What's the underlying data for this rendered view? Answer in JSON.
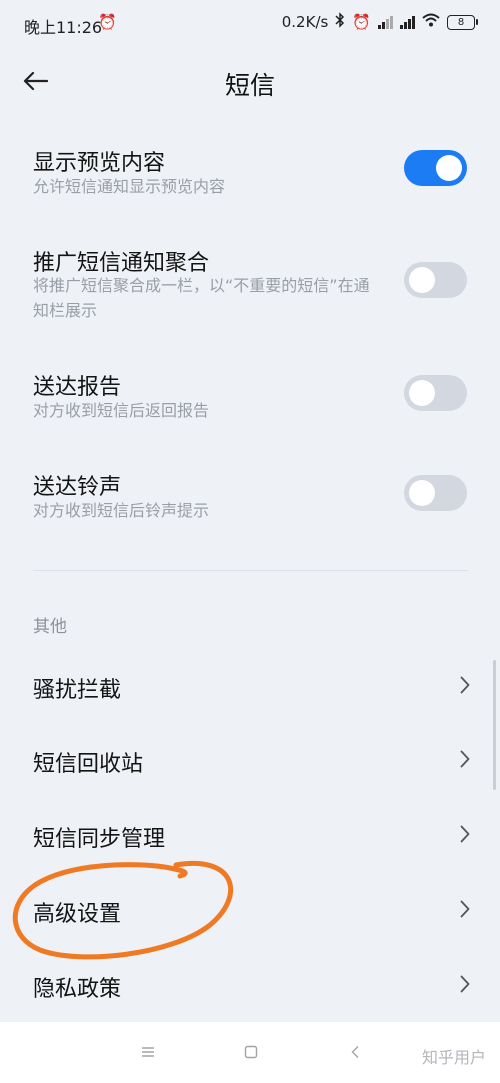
{
  "status_bar": {
    "time": "晚上11:26",
    "network_speed": "0.2K/s",
    "battery": "8",
    "icons": [
      "alarm-icon",
      "bluetooth-icon",
      "signal-icon",
      "hd-signal-icon",
      "wifi-icon",
      "battery-icon"
    ]
  },
  "header": {
    "title": "短信",
    "back_icon": "arrow-left-icon"
  },
  "settings": [
    {
      "label": "显示预览内容",
      "desc": "允许短信通知显示预览内容",
      "enabled": true
    },
    {
      "label": "推广短信通知聚合",
      "desc": "将推广短信聚合成一栏，以“不重要的短信”在通知栏展示",
      "enabled": false
    },
    {
      "label": "送达报告",
      "desc": "对方收到短信后返回报告",
      "enabled": false
    },
    {
      "label": "送达铃声",
      "desc": "对方收到短信后铃声提示",
      "enabled": false
    }
  ],
  "other_section": {
    "title": "其他",
    "items": [
      {
        "label": "骚扰拦截"
      },
      {
        "label": "短信回收站"
      },
      {
        "label": "短信同步管理"
      },
      {
        "label": "高级设置"
      },
      {
        "label": "隐私政策"
      }
    ]
  },
  "colors": {
    "toggle_on": "#1b7cf3",
    "toggle_off": "#d3d7df",
    "background": "#eef1f6",
    "annotation": "#f07a23"
  },
  "watermark": "知乎用户"
}
